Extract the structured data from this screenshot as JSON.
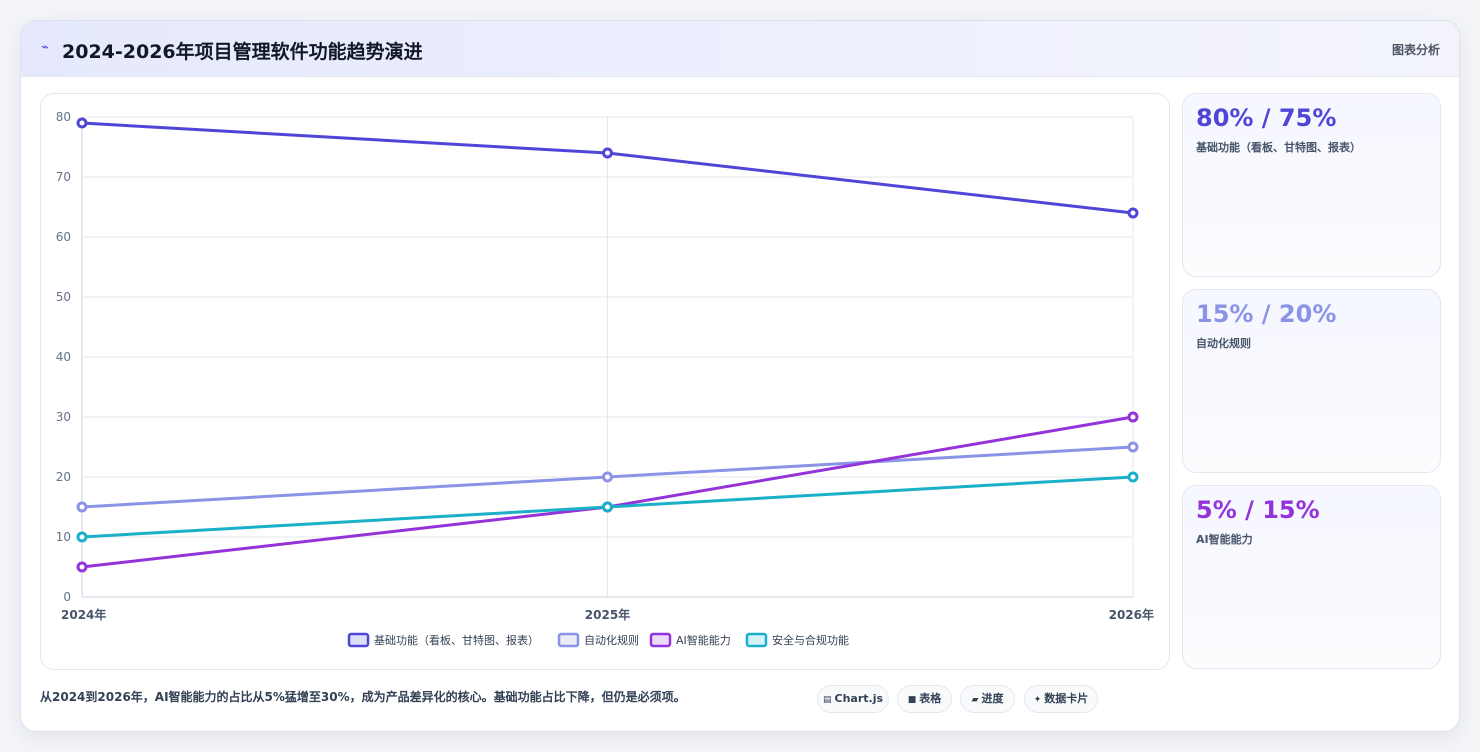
{
  "header": {
    "icon": "chart-line-icon",
    "title": "2024-2026年项目管理软件功能趋势演进",
    "tag": "图表分析"
  },
  "chart_data": {
    "type": "line",
    "categories": [
      "2024年",
      "2025年",
      "2026年"
    ],
    "ylim": [
      0,
      80
    ],
    "yticks": [
      0,
      10,
      20,
      30,
      40,
      50,
      60,
      70,
      80
    ],
    "grid": true,
    "legend_position": "bottom",
    "series": [
      {
        "name": "基础功能（看板、甘特图、报表）",
        "color": "#4f46d8",
        "values": [
          79,
          74,
          64
        ]
      },
      {
        "name": "自动化规则",
        "color": "#8b93e6",
        "values": [
          15,
          20,
          25
        ]
      },
      {
        "name": "AI智能能力",
        "color": "#9333d9",
        "values": [
          5,
          15,
          30
        ]
      },
      {
        "name": "安全与合规功能",
        "color": "#1ab0c8",
        "values": [
          10,
          15,
          20
        ]
      }
    ]
  },
  "stats": [
    {
      "value": "80% / 75%",
      "label": "基础功能（看板、甘特图、报表）",
      "color": "#4f46d8"
    },
    {
      "value": "15% / 20%",
      "label": "自动化规则",
      "color": "#8b93e6"
    },
    {
      "value": "5% / 15%",
      "label": "AI智能能力",
      "color": "#9333d9"
    }
  ],
  "footer": {
    "text": "从2024到2026年，AI智能能力的占比从5%猛增至30%，成为产品差异化的核心。基础功能占比下降，但仍是必须项。",
    "pills": [
      {
        "icon": "chart-icon",
        "glyph": "▤",
        "label": "Chart.js"
      },
      {
        "icon": "table-icon",
        "glyph": "■",
        "label": "表格"
      },
      {
        "icon": "progress-icon",
        "glyph": "▰",
        "label": "进度"
      },
      {
        "icon": "sparkle-icon",
        "glyph": "✦",
        "label": "数据卡片"
      }
    ]
  }
}
